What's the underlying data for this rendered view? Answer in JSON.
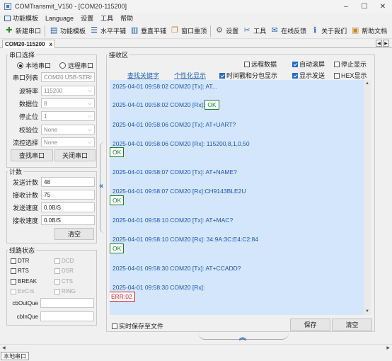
{
  "window": {
    "title": "COMTransmit_V150 - [COM20-115200]",
    "minimize": "–",
    "maximize": "☐",
    "close": "✕"
  },
  "menu": {
    "items": [
      "功能模板",
      "Language",
      "设置",
      "工具",
      "帮助"
    ]
  },
  "toolbar": {
    "new_port": "新建串口",
    "func_template": "功能模板",
    "horizontal_tile": "水平平铺",
    "vertical_tile": "垂直平铺",
    "cascade": "窗口重顶",
    "settings": "设置",
    "tools": "工具",
    "feedback": "在线反馈",
    "about": "关于我们",
    "help_doc": "帮助文档"
  },
  "tab": {
    "label": "COM20-115200",
    "close": "x",
    "nav_left": "◀",
    "nav_right": "▶"
  },
  "port_select": {
    "legend": "串口选择",
    "local_port": "本地串口",
    "remote_port": "远程串口",
    "selected": "local",
    "fields": [
      {
        "label": "串口列表",
        "value": "COM20 USB-SERI",
        "arrow": "⌵"
      },
      {
        "label": "波特率",
        "value": "115200",
        "arrow": "⌵"
      },
      {
        "label": "数据位",
        "value": "8",
        "arrow": "⌵"
      },
      {
        "label": "停止位",
        "value": "1",
        "arrow": "⌵"
      },
      {
        "label": "校验位",
        "value": "None",
        "arrow": "⌵"
      },
      {
        "label": "流控选择",
        "value": "None",
        "arrow": "⌵"
      }
    ],
    "find_button": "查找串口",
    "close_button": "关闭串口"
  },
  "counters": {
    "legend": "计数",
    "rows": [
      {
        "label": "发送计数",
        "value": "48"
      },
      {
        "label": "接收计数",
        "value": "75"
      },
      {
        "label": "发送速度",
        "value": "0.0B/S"
      },
      {
        "label": "接收速度",
        "value": "0.0B/S"
      }
    ],
    "clear_button": "清空"
  },
  "line_status": {
    "legend": "线路状态",
    "items": [
      {
        "label": "DTR",
        "enabled": true
      },
      {
        "label": "DCD",
        "enabled": false
      },
      {
        "label": "RTS",
        "enabled": true
      },
      {
        "label": "DSR",
        "enabled": false
      },
      {
        "label": "BREAK",
        "enabled": true
      },
      {
        "label": "CTS",
        "enabled": false
      },
      {
        "label": "ErrCnt",
        "enabled": false
      },
      {
        "label": "RING",
        "enabled": false
      }
    ],
    "out_que_label": "cbOutQue",
    "in_que_label": "cbInQue"
  },
  "receive": {
    "legend": "接收区",
    "options": {
      "remote_data": {
        "label": "远程数据",
        "checked": false
      },
      "auto_scroll": {
        "label": "自动滚屏",
        "checked": true
      },
      "stop_display": {
        "label": "停止显示",
        "checked": false
      },
      "timestamp_split": {
        "label": "时间戳和分包显示",
        "checked": true
      },
      "show_send": {
        "label": "显示发送",
        "checked": true
      },
      "hex_display": {
        "label": "HEX显示",
        "checked": false
      }
    },
    "find_keyword": "查找关键字",
    "personalize": "个性化显示",
    "lines": [
      {
        "text": "2025-04-01 09:58:02 COM20 [Tx]: AT..."
      },
      {
        "text": "2025-04-01 09:58:02 COM20 [Rx]:",
        "box": "OK",
        "box_type": "ok"
      },
      {
        "text": "2025-04-01 09:58:06 COM20 [Tx]: AT+UART?"
      },
      {
        "text": "2025-04-01 09:58:06 COM20 [Rx]: 115200,8,1,0,50"
      },
      {
        "box": "OK",
        "box_type": "ok"
      },
      {
        "text": "2025-04-01 09:58:07 COM20 [Tx]: AT+NAME?"
      },
      {
        "text": "2025-04-01 09:58:07 COM20 [Rx]:CH9143BLE2U"
      },
      {
        "box": "OK",
        "box_type": "ok"
      },
      {
        "text": "2025-04-01 09:58:10 COM20 [Tx]: AT+MAC?"
      },
      {
        "text": "2025-04-01 09:58:10 COM20 [Rx]: 34:9A:3C:E4:C2:84"
      },
      {
        "box": "OK",
        "box_type": "ok"
      },
      {
        "text": "2025-04-01 09:58:30 COM20 [Tx]: AT+CCADD?"
      },
      {
        "text": "2025-04-01 09:58:30 COM20 [Rx]:"
      },
      {
        "box": "ERR:02",
        "box_type": "err"
      }
    ],
    "realtime_save": "实时保存至文件",
    "save_button": "保存",
    "clear_button": "清空"
  },
  "statusbar": {
    "text": "本地串口"
  }
}
